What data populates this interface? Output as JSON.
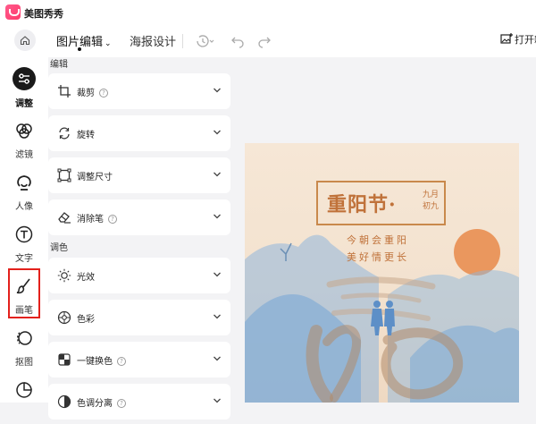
{
  "app": {
    "title": "美图秀秀"
  },
  "sidebar": {
    "items": [
      {
        "label": "调整",
        "icon": "adjust-icon",
        "active": true
      },
      {
        "label": "滤镜",
        "icon": "filter-icon"
      },
      {
        "label": "人像",
        "icon": "portrait-icon"
      },
      {
        "label": "文字",
        "icon": "text-icon"
      },
      {
        "label": "画笔",
        "icon": "brush-icon",
        "highlighted": true
      },
      {
        "label": "抠图",
        "icon": "cutout-icon"
      },
      {
        "label": "",
        "icon": "sticker-icon"
      }
    ]
  },
  "toolbar": {
    "tab_edit": "图片编辑",
    "tab_poster": "海报设计",
    "open_label": "打开新"
  },
  "panel": {
    "section_edit": "编辑",
    "edit_items": [
      {
        "label": "裁剪",
        "icon": "crop-icon",
        "help": true
      },
      {
        "label": "旋转",
        "icon": "rotate-icon",
        "help": false
      },
      {
        "label": "调整尺寸",
        "icon": "resize-icon",
        "help": false
      },
      {
        "label": "消除笔",
        "icon": "eraser-icon",
        "help": true
      }
    ],
    "section_color": "调色",
    "color_items": [
      {
        "label": "光效",
        "icon": "light-icon",
        "help": false
      },
      {
        "label": "色彩",
        "icon": "color-icon",
        "help": false
      },
      {
        "label": "一键换色",
        "icon": "recolor-icon",
        "help": true
      },
      {
        "label": "色调分离",
        "icon": "split-tone-icon",
        "help": true
      }
    ],
    "help_glyph": "?"
  },
  "poster": {
    "title": "重阳节·",
    "title_side": "九月初九",
    "line1": "今朝会重阳",
    "line2": "美好情更长"
  },
  "colors": {
    "accent": "#e3211c",
    "poster_text": "#c0723a",
    "sun": "#e88a4a",
    "mountain": "#8fb7dc"
  }
}
